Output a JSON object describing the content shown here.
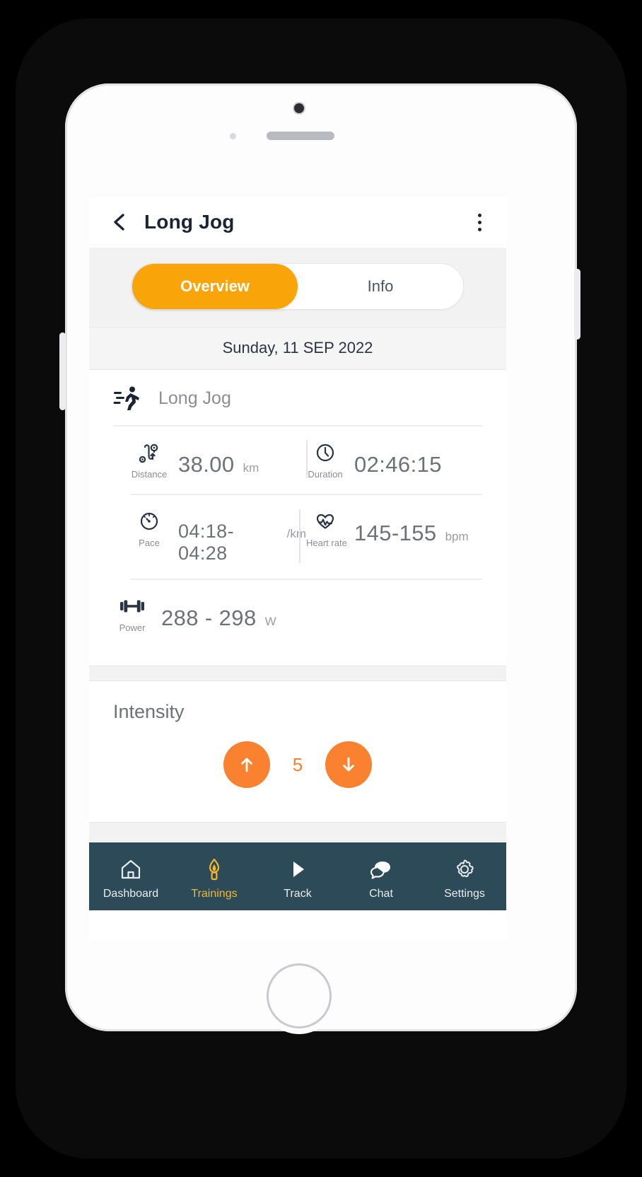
{
  "header": {
    "back_icon": "chevron-left-icon",
    "title": "Long Jog",
    "menu_icon": "kebab-menu-icon"
  },
  "tabs": [
    {
      "label": "Overview",
      "active": true
    },
    {
      "label": "Info",
      "active": false
    }
  ],
  "date": "Sunday, 11 SEP 2022",
  "activity": {
    "icon": "running-person-icon",
    "name": "Long Jog"
  },
  "metrics": [
    {
      "icon": "route-pin-icon",
      "label": "Distance",
      "value": "38.00",
      "unit": "km"
    },
    {
      "icon": "clock-icon",
      "label": "Duration",
      "value": "02:46:15",
      "unit": ""
    },
    {
      "icon": "speedometer-icon",
      "label": "Pace",
      "value": "04:18-04:28",
      "unit": "/km"
    },
    {
      "icon": "heart-pulse-icon",
      "label": "Heart rate",
      "value": "145-155",
      "unit": "bpm"
    },
    {
      "icon": "dumbbell-icon",
      "label": "Power",
      "value": "288 - 298",
      "unit": "W"
    }
  ],
  "intensity": {
    "title": "Intensity",
    "increase_icon": "arrow-up-icon",
    "decrease_icon": "arrow-down-icon",
    "value": "5"
  },
  "bottom_nav": [
    {
      "label": "Dashboard",
      "icon": "home-icon",
      "active": false
    },
    {
      "label": "Trainings",
      "icon": "torch-icon",
      "active": true
    },
    {
      "label": "Track",
      "icon": "play-icon",
      "active": false
    },
    {
      "label": "Chat",
      "icon": "chat-bubbles-icon",
      "active": false
    },
    {
      "label": "Settings",
      "icon": "gear-icon",
      "active": false
    }
  ],
  "colors": {
    "accent_orange": "#f9a50a",
    "intensity_orange": "#f9812f",
    "nav_background": "#2c4a58",
    "nav_active": "#f6b72a"
  }
}
